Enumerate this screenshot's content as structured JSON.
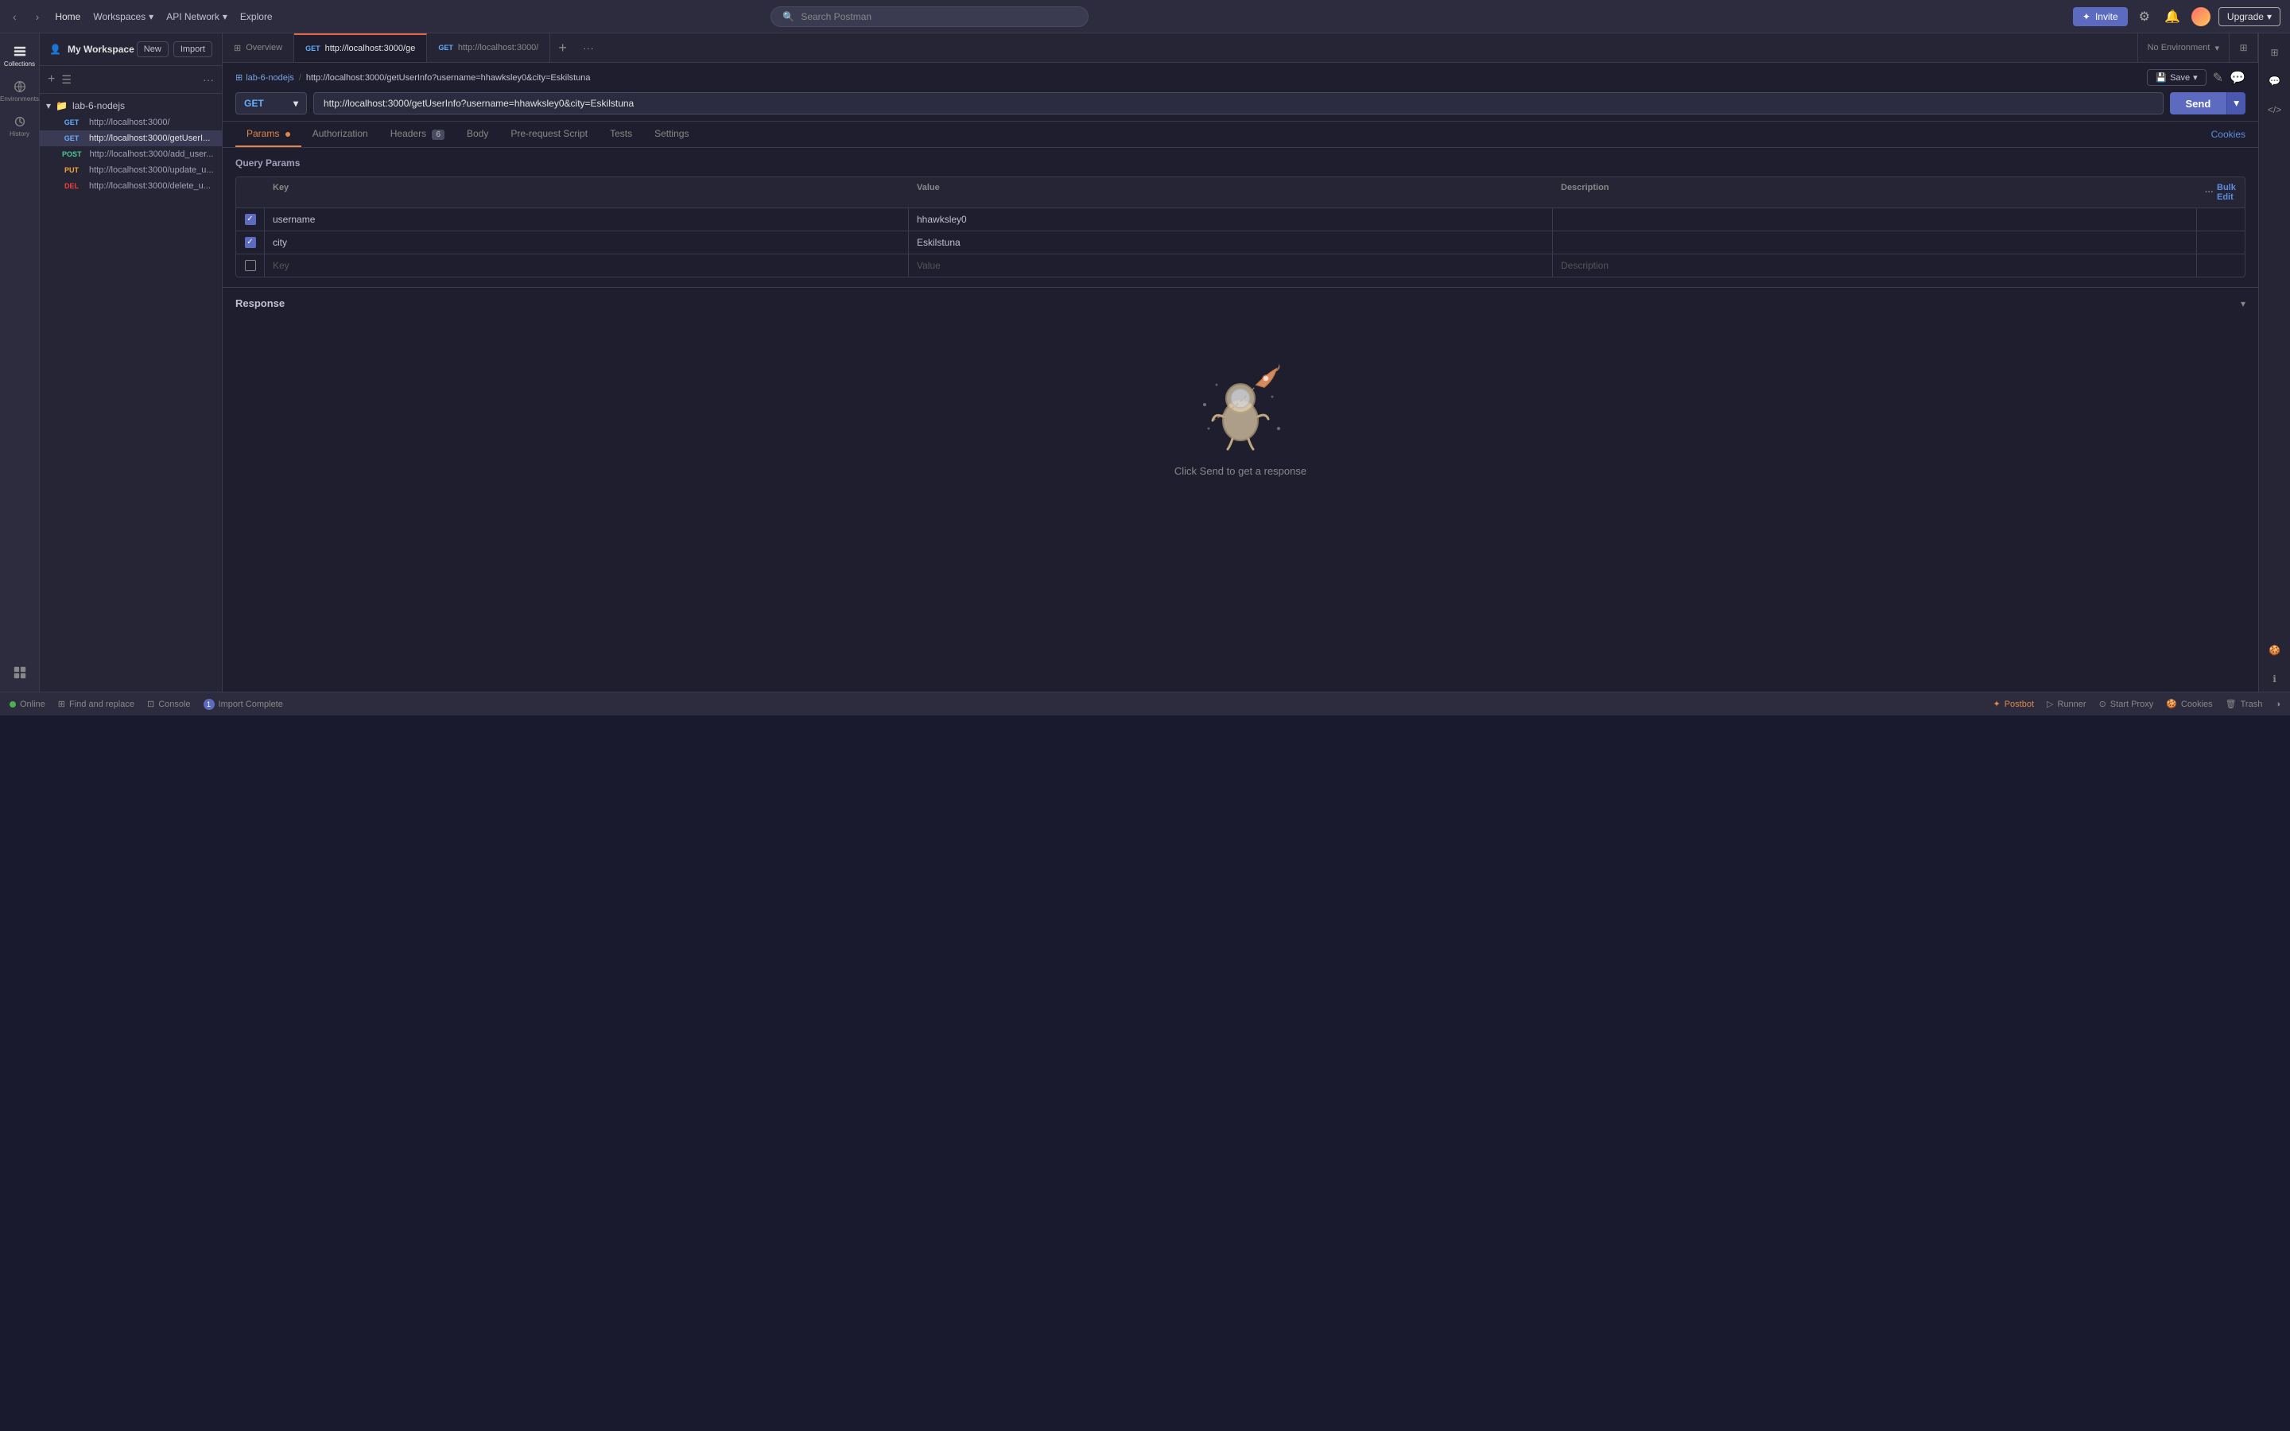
{
  "topnav": {
    "home": "Home",
    "workspaces": "Workspaces",
    "api_network": "API Network",
    "explore": "Explore",
    "search_placeholder": "Search Postman",
    "invite_label": "Invite",
    "upgrade_label": "Upgrade"
  },
  "workspace": {
    "title": "My Workspace",
    "new_label": "New",
    "import_label": "Import"
  },
  "sidebar": {
    "collections_label": "Collections",
    "environments_label": "Environments",
    "history_label": "History",
    "add_icon": "+",
    "more_icon": "···"
  },
  "collection": {
    "name": "lab-6-nodejs",
    "items": [
      {
        "method": "GET",
        "url": "http://localhost:3000/"
      },
      {
        "method": "GET",
        "url": "http://localhost:3000/getUserI...",
        "active": true
      },
      {
        "method": "POST",
        "url": "http://localhost:3000/add_user..."
      },
      {
        "method": "PUT",
        "url": "http://localhost:3000/update_u..."
      },
      {
        "method": "DEL",
        "url": "http://localhost:3000/delete_u..."
      }
    ]
  },
  "tabs": [
    {
      "label": "Overview",
      "type": "overview"
    },
    {
      "method": "GET",
      "url": "http://localhost:3000/ge",
      "active": true
    },
    {
      "method": "GET",
      "url": "http://localhost:3000/"
    }
  ],
  "environment": {
    "label": "No Environment"
  },
  "breadcrumb": {
    "collection": "lab-6-nodejs",
    "separator": "/",
    "current": "http://localhost:3000/getUserInfo?username=hhawksley0&city=Eskilstuna"
  },
  "request": {
    "method": "GET",
    "url": "http://localhost:3000/getUserInfo?username=hhawksley0&city=Eskilstuna",
    "send_label": "Send",
    "save_label": "Save"
  },
  "param_tabs": {
    "params": "Params",
    "authorization": "Authorization",
    "headers": "Headers",
    "headers_count": "6",
    "body": "Body",
    "pre_request_script": "Pre-request Script",
    "tests": "Tests",
    "settings": "Settings",
    "cookies": "Cookies"
  },
  "query_params": {
    "title": "Query Params",
    "columns": {
      "key": "Key",
      "value": "Value",
      "description": "Description",
      "bulk_edit": "Bulk Edit"
    },
    "rows": [
      {
        "checked": true,
        "key": "username",
        "value": "hhawksley0",
        "description": ""
      },
      {
        "checked": true,
        "key": "city",
        "value": "Eskilstuna",
        "description": ""
      },
      {
        "checked": false,
        "key": "",
        "value": "",
        "description": ""
      }
    ],
    "placeholder_key": "Key",
    "placeholder_value": "Value",
    "placeholder_description": "Description"
  },
  "response": {
    "title": "Response",
    "empty_message": "Click Send to get a response"
  },
  "bottom_bar": {
    "online": "Online",
    "find_replace": "Find and replace",
    "console": "Console",
    "import_complete": "Import Complete",
    "import_count": "1",
    "postbot": "Postbot",
    "runner": "Runner",
    "start_proxy": "Start Proxy",
    "cookies": "Cookies",
    "trash": "Trash",
    "theme_icon": "◑"
  }
}
